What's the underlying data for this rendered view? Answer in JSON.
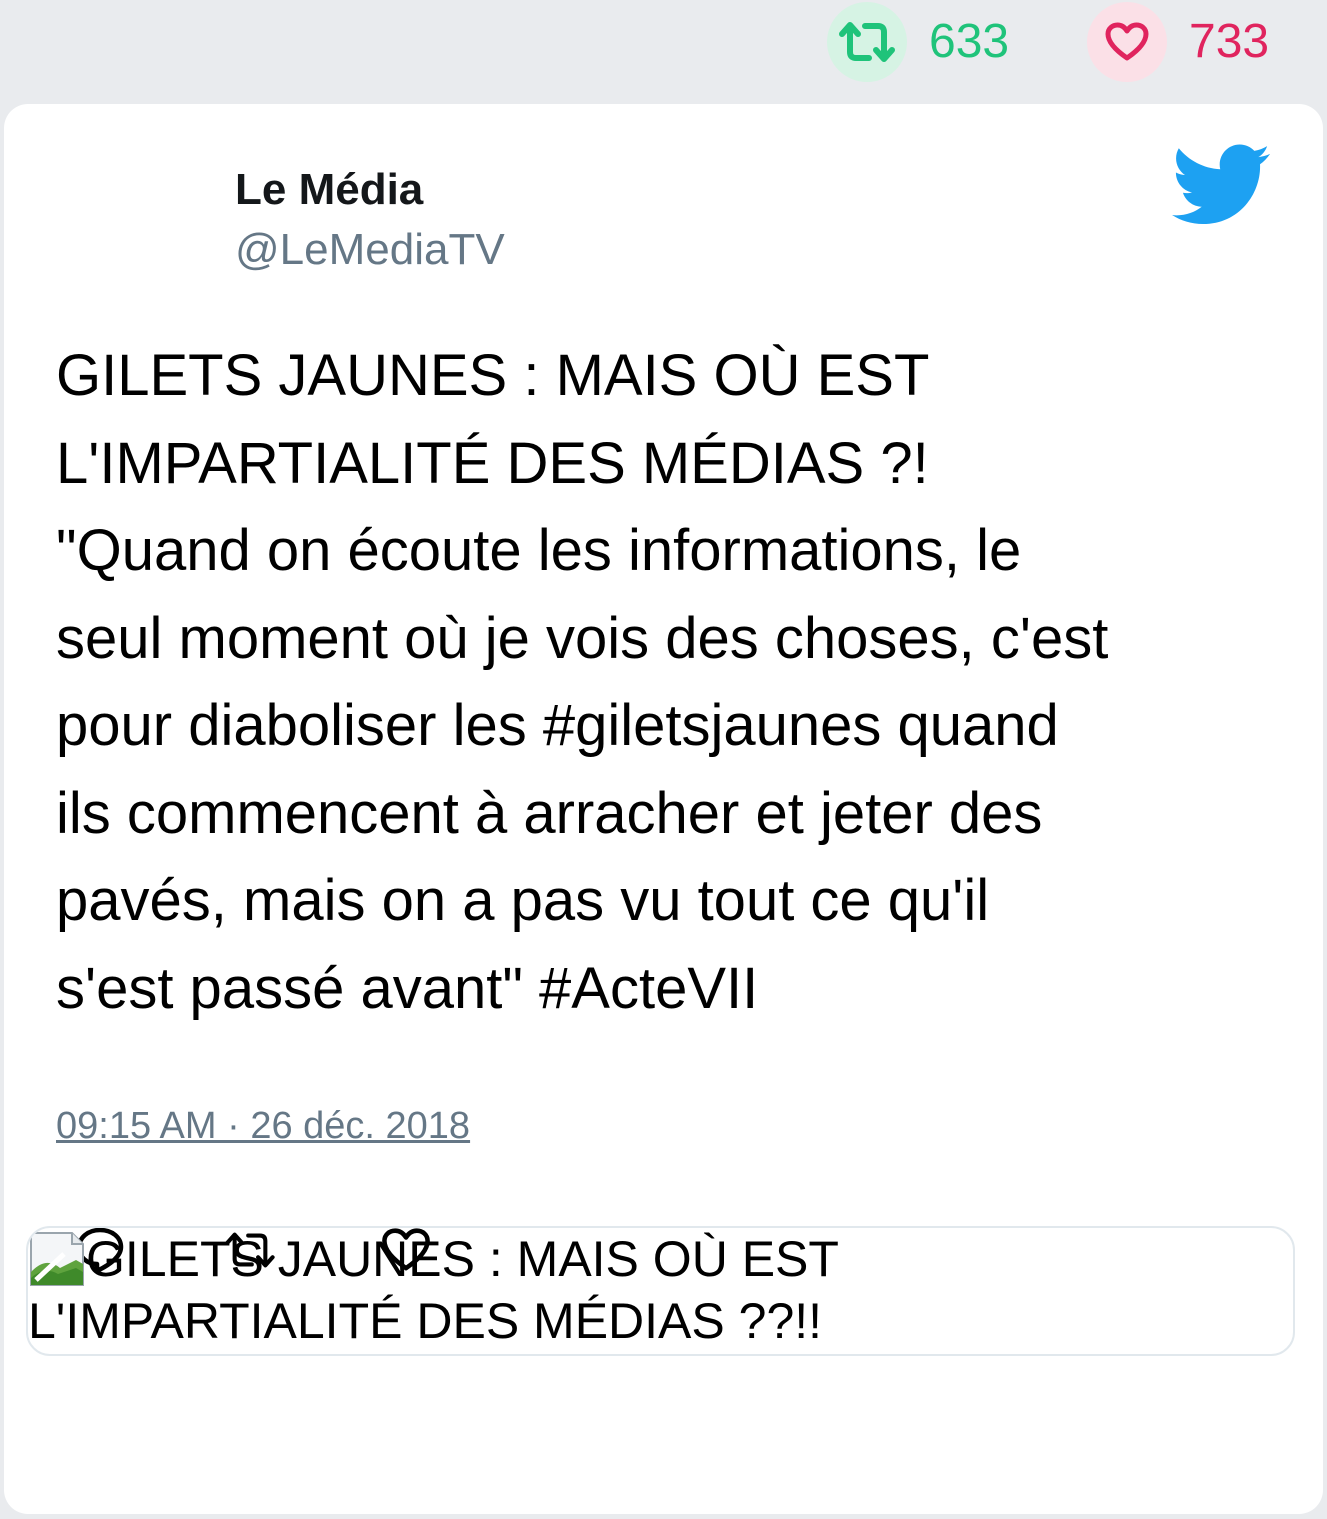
{
  "stats": {
    "retweets_icon": "retweet-icon",
    "retweets_count": "633",
    "likes_icon": "heart-icon",
    "likes_count": "733"
  },
  "author": {
    "name": "Le Média",
    "handle": "@LeMediaTV",
    "brand_icon": "twitter-bird-icon"
  },
  "tweet": {
    "text": "GILETS JAUNES : MAIS OÙ EST\nL'IMPARTIALITÉ DES MÉDIAS ?!\n\"Quand on écoute les informations, le\nseul moment où je vois des choses, c'est\npour diaboliser les #giletsjaunes quand\nils commencent à arracher et jeter des\npavés, mais on a pas vu tout ce qu'il\ns'est passé avant\" #ActeVII",
    "timestamp": "09:15 AM · 26 déc. 2018"
  },
  "actions": {
    "reply_icon": "reply-icon",
    "retweet_icon": "retweet-icon",
    "like_icon": "heart-icon"
  },
  "link_card": {
    "image_icon": "broken-image-icon",
    "title": "GILETS JAUNES : MAIS OÙ EST L'IMPARTIALITÉ DES MÉDIAS ??!!"
  },
  "colors": {
    "background": "#e9ebee",
    "retweet_green": "#1fc37a",
    "like_red": "#e0245e",
    "twitter_blue": "#1da1f2",
    "muted_text": "#657786"
  }
}
